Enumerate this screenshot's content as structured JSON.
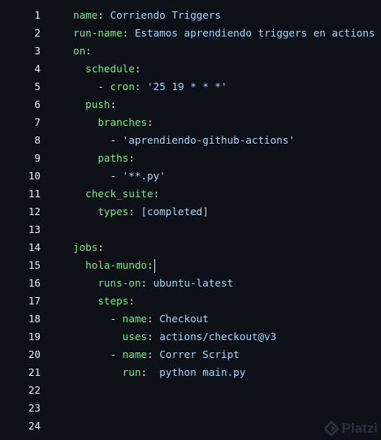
{
  "editor": {
    "lines": [
      {
        "n": "1",
        "indent": "",
        "key": "name",
        "sep": ": ",
        "value": "Corriendo Triggers"
      },
      {
        "n": "2",
        "indent": "",
        "key": "run-name",
        "sep": ": ",
        "value": "Estamos aprendiendo triggers en actions"
      },
      {
        "n": "3",
        "indent": "",
        "key": "on",
        "sep": ":",
        "value": ""
      },
      {
        "n": "4",
        "indent": "  ",
        "key": "schedule",
        "sep": ":",
        "value": ""
      },
      {
        "n": "5",
        "indent": "    ",
        "dash": "- ",
        "key": "cron",
        "sep": ": ",
        "value": "'25 19 * * *'"
      },
      {
        "n": "6",
        "indent": "  ",
        "key": "push",
        "sep": ":",
        "value": ""
      },
      {
        "n": "7",
        "indent": "    ",
        "key": "branches",
        "sep": ":",
        "value": ""
      },
      {
        "n": "8",
        "indent": "      ",
        "dash": "- ",
        "key": "",
        "sep": "",
        "value": "'aprendiendo-github-actions'"
      },
      {
        "n": "9",
        "indent": "    ",
        "key": "paths",
        "sep": ":",
        "value": ""
      },
      {
        "n": "10",
        "indent": "      ",
        "dash": "- ",
        "key": "",
        "sep": "",
        "value": "'**.py'"
      },
      {
        "n": "11",
        "indent": "  ",
        "key": "check_suite",
        "sep": ":",
        "value": ""
      },
      {
        "n": "12",
        "indent": "    ",
        "key": "types",
        "sep": ": ",
        "value": "[completed]"
      },
      {
        "n": "13",
        "indent": "",
        "key": "",
        "sep": "",
        "value": ""
      },
      {
        "n": "14",
        "indent": "",
        "key": "jobs",
        "sep": ":",
        "value": ""
      },
      {
        "n": "15",
        "indent": "  ",
        "key": "hola-mundo",
        "sep": ":",
        "value": "",
        "cursor": true
      },
      {
        "n": "16",
        "indent": "    ",
        "key": "runs-on",
        "sep": ": ",
        "value": "ubuntu-latest"
      },
      {
        "n": "17",
        "indent": "    ",
        "key": "steps",
        "sep": ":",
        "value": ""
      },
      {
        "n": "18",
        "indent": "      ",
        "dash": "- ",
        "key": "name",
        "sep": ": ",
        "value": "Checkout"
      },
      {
        "n": "19",
        "indent": "        ",
        "key": "uses",
        "sep": ": ",
        "value": "actions/checkout@v3"
      },
      {
        "n": "20",
        "indent": "      ",
        "dash": "- ",
        "key": "name",
        "sep": ": ",
        "value": "Correr Script"
      },
      {
        "n": "21",
        "indent": "        ",
        "key": "run",
        "sep": ":  ",
        "value": "python main.py"
      },
      {
        "n": "22",
        "indent": "",
        "key": "",
        "sep": "",
        "value": ""
      },
      {
        "n": "23",
        "indent": "",
        "key": "",
        "sep": "",
        "value": ""
      },
      {
        "n": "24",
        "indent": "",
        "key": "",
        "sep": "",
        "value": ""
      }
    ]
  },
  "watermark": {
    "text": "Platzi",
    "icon": "platzi-logo-icon"
  },
  "colors": {
    "background": "#0d1117",
    "text": "#e6edf3",
    "key": "#7ee787",
    "string": "#a5d6ff"
  }
}
